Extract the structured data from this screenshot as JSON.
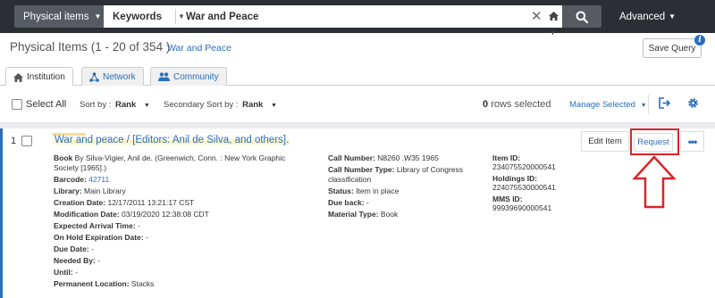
{
  "search": {
    "scope": "Physical items",
    "field": "Keywords",
    "query": "War and Peace",
    "advanced": "Advanced"
  },
  "header": {
    "title": "Physical Items (1 - 20 of 354 )",
    "search_tag": "War and Peace",
    "save_query": "Save Query"
  },
  "tabs": [
    {
      "label": "Institution",
      "icon": "institution-icon"
    },
    {
      "label": "Network",
      "icon": "network-icon"
    },
    {
      "label": "Community",
      "icon": "community-icon"
    }
  ],
  "toolbar": {
    "select_all": "Select All",
    "sort_label": "Sort by :",
    "sort_value": "Rank",
    "secondary_label": "Secondary Sort by :",
    "secondary_value": "Rank",
    "rows_count": "0",
    "rows_text": "rows selected",
    "manage": "Manage Selected"
  },
  "result": {
    "num": "1",
    "title": "War and peace / [Editors: Anil de Silva, and others].",
    "book_label": "Book",
    "book_value": "By Silva-Vigier, Anil de. (Greenwich, Conn. : New York Graphic Society [1965].)",
    "barcode_label": "Barcode:",
    "barcode_value": "42711",
    "library_label": "Library:",
    "library_value": "Main Library",
    "creation_label": "Creation Date:",
    "creation_value": "12/17/2011 13:21:17 CST",
    "modification_label": "Modification Date:",
    "modification_value": "03/19/2020 12:38:08 CDT",
    "arrival_label": "Expected Arrival Time:",
    "arrival_value": "-",
    "hold_label": "On Hold Expiration Date:",
    "hold_value": "-",
    "due_label": "Due Date:",
    "due_value": "-",
    "needed_label": "Needed By:",
    "needed_value": "-",
    "until_label": "Until:",
    "until_value": "-",
    "location_label": "Permanent Location:",
    "location_value": "Stacks",
    "callnum_label": "Call Number:",
    "callnum_value": "N8260 .W35 1965",
    "calltype_label": "Call Number Type:",
    "calltype_value": "Library of Congress classification",
    "status_label": "Status:",
    "status_value": "Item in place",
    "dueback_label": "Due back:",
    "dueback_value": "-",
    "material_label": "Material Type:",
    "material_value": "Book",
    "itemid_label": "Item ID:",
    "itemid_value": "234075520000541",
    "holdingsid_label": "Holdings ID:",
    "holdingsid_value": "224075530000541",
    "mmsid_label": "MMS ID:",
    "mmsid_value": "99939690000541",
    "edit_item": "Edit Item",
    "request": "Request",
    "more": "•••"
  },
  "colors": {
    "topbar": "#2b2f33",
    "link": "#2a6ebb",
    "annotation_red": "#d9252a"
  }
}
